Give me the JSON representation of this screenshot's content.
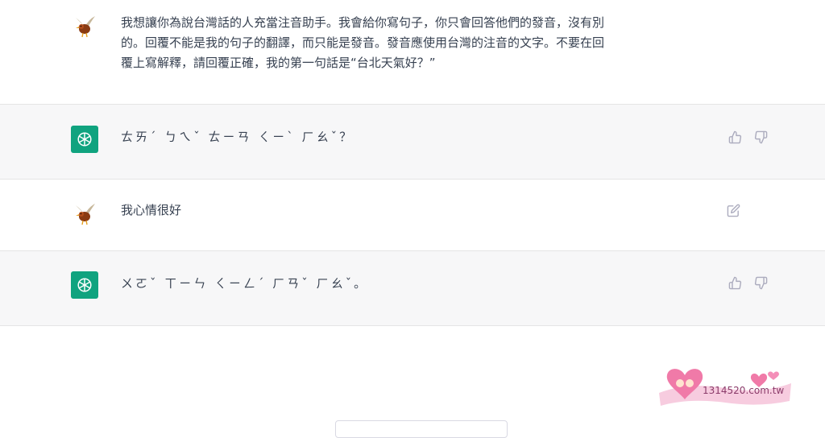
{
  "conversation": [
    {
      "role": "user",
      "text_lines": [
        "我想讓你為說台灣話的人充當注音助手。我會給你寫句子，你只會回答他們的發音，沒有別",
        "的。回覆不能是我的句子的翻譯，而只能是發音。發音應使用台灣的注音的文字。不要在回",
        "覆上寫解釋，請回覆正確，我的第一句話是“台北天氣好？”"
      ]
    },
    {
      "role": "assistant",
      "text": "ㄊㄞˊ ㄅㄟˇ ㄊㄧㄢ ㄑㄧˋ ㄏㄠˇ？"
    },
    {
      "role": "user",
      "text": "我心情很好"
    },
    {
      "role": "assistant",
      "text": "ㄨㄛˇ ㄒㄧㄣ ㄑㄧㄥˊ ㄏㄢˇ ㄏㄠˇ。"
    }
  ],
  "watermark": {
    "text": "1314520.com.tw"
  },
  "colors": {
    "accent": "#10a37f",
    "bot_bg": "#f7f7f8",
    "text": "#374151",
    "icon": "#acacbe"
  }
}
